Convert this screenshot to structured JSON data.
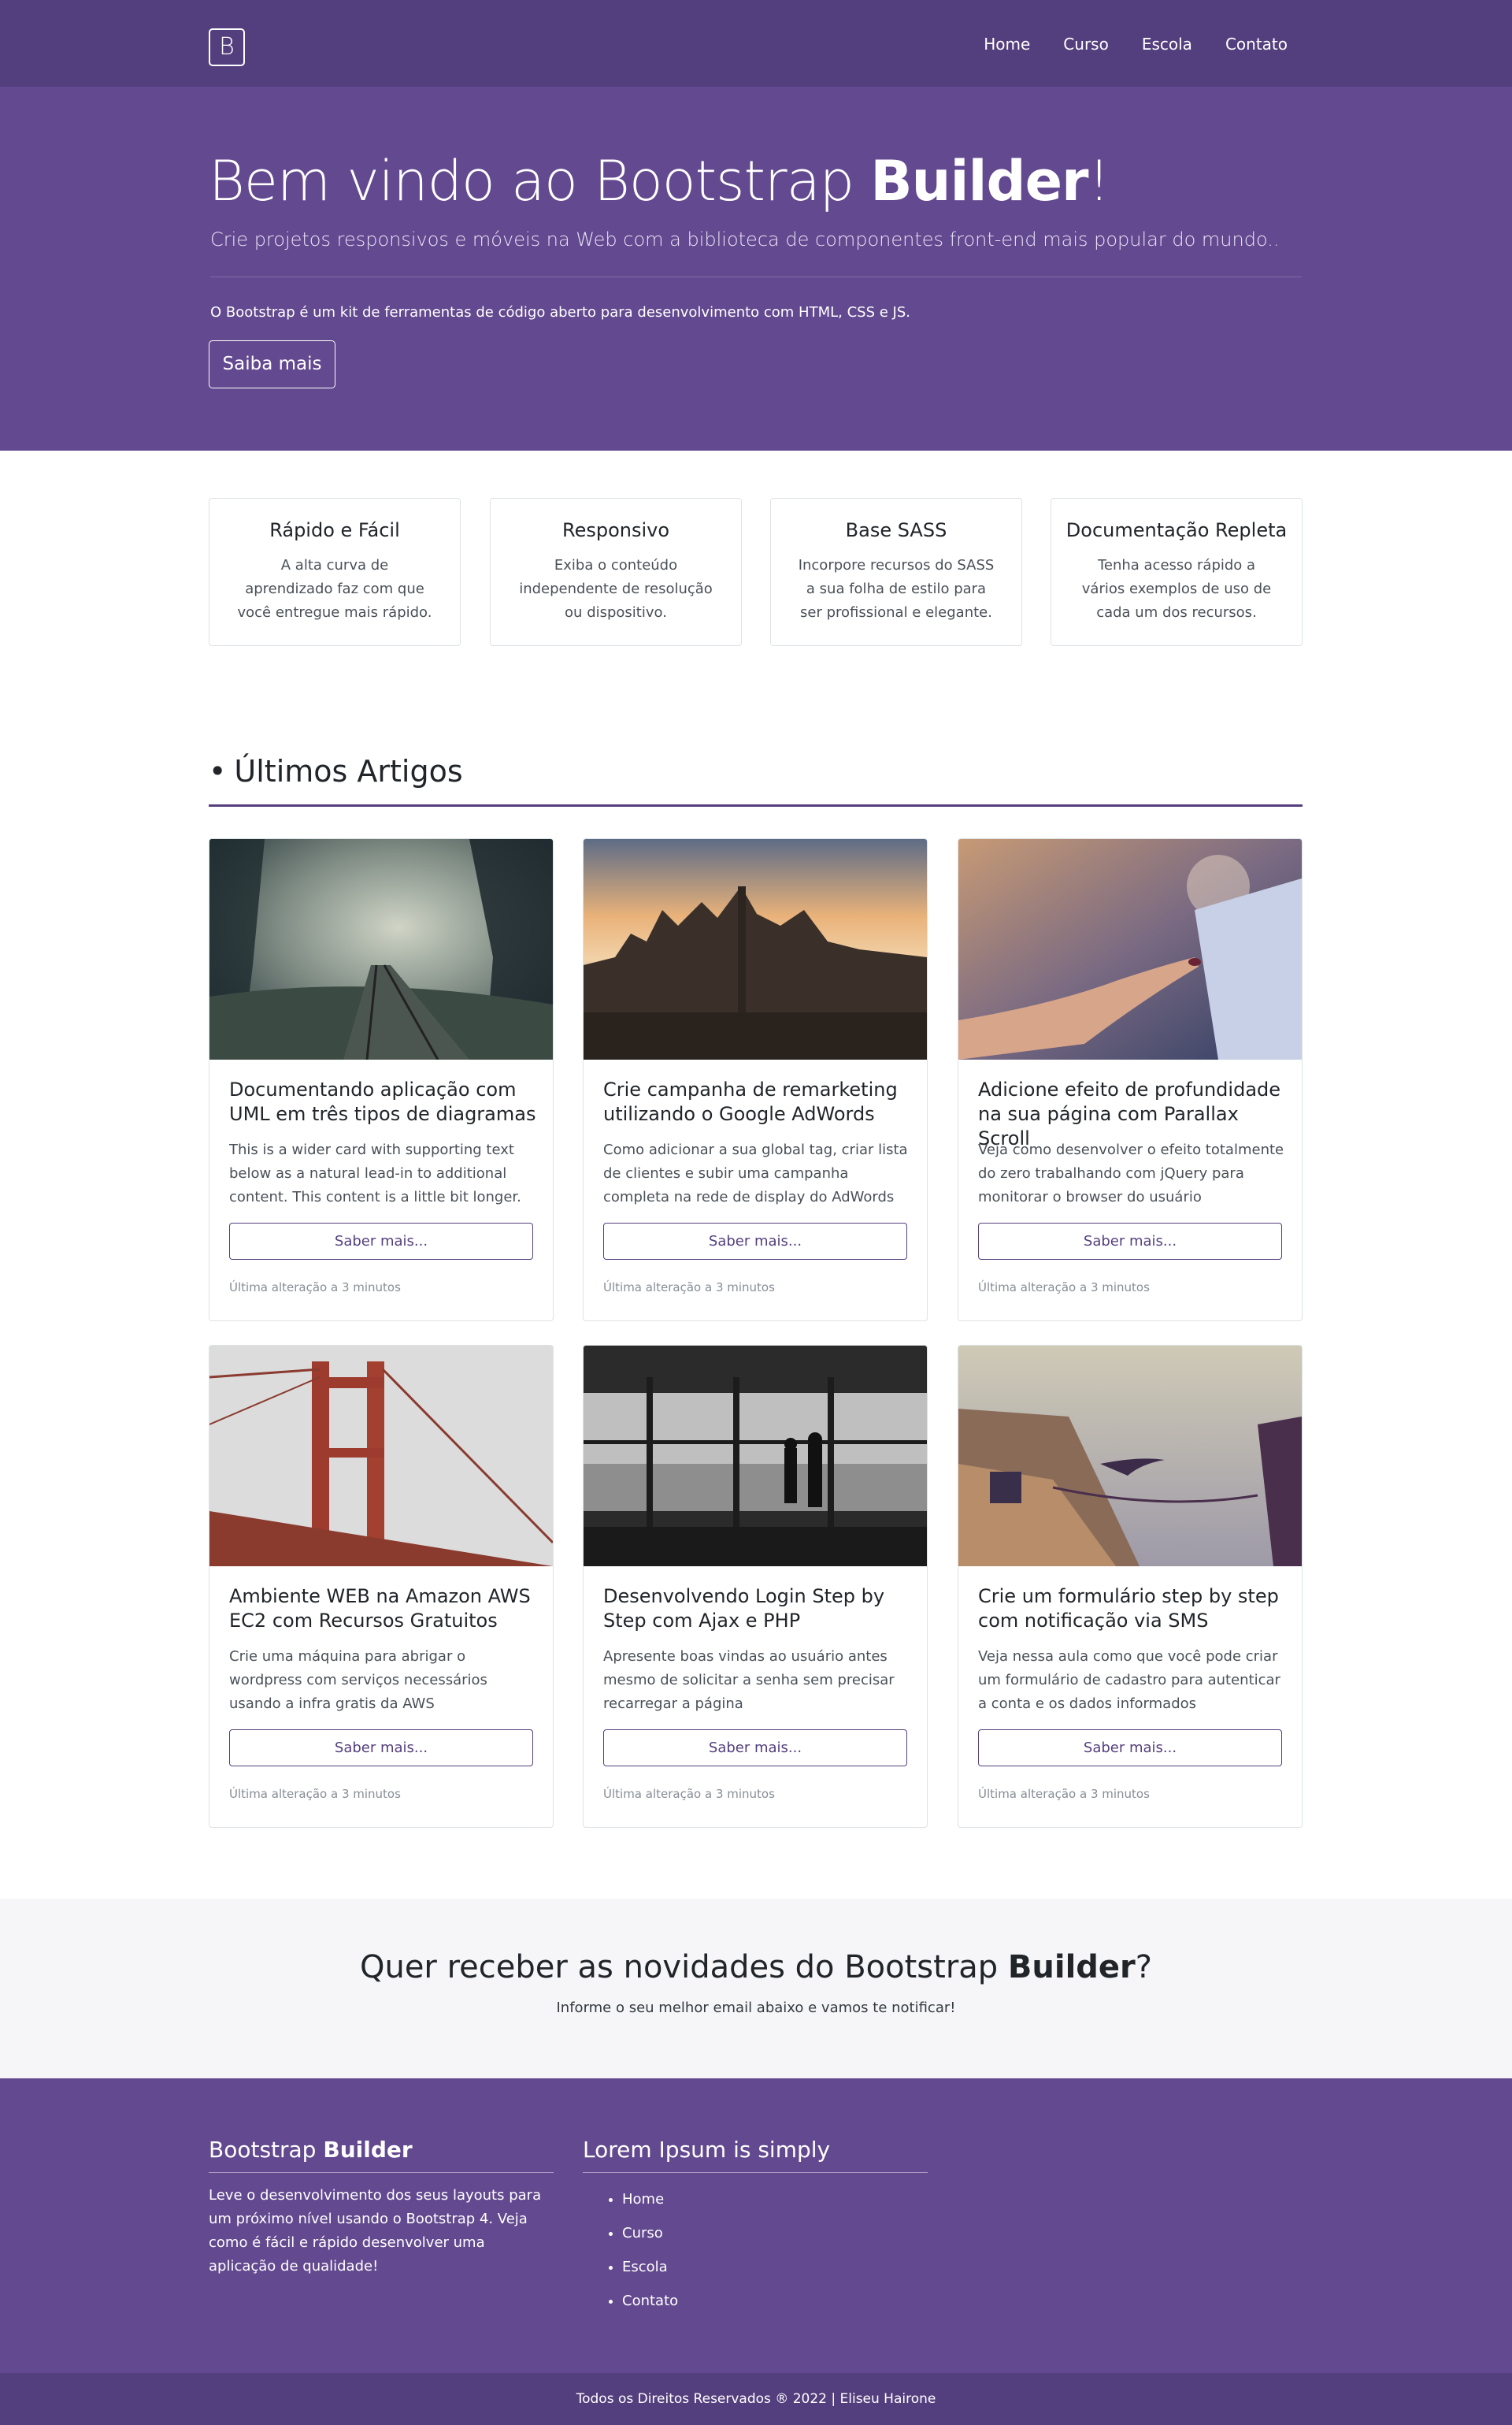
{
  "navbar": {
    "brand": "B",
    "links": [
      "Home",
      "Curso",
      "Escola",
      "Contato"
    ]
  },
  "hero": {
    "title_prefix": "Bem vindo ao Bootstrap ",
    "title_bold": "Builder",
    "title_suffix": "!",
    "lead": "Crie projetos responsivos e móveis na Web com a biblioteca de componentes front-end mais popular do mundo..",
    "description": "O Bootstrap é um kit de ferramentas de código aberto para desenvolvimento com HTML, CSS e JS.",
    "cta": "Saiba mais"
  },
  "features": [
    {
      "title": "Rápido e Fácil",
      "text": "A alta curva de aprendizado faz com que você entregue mais rápido."
    },
    {
      "title": "Responsivo",
      "text": "Exiba o conteúdo independente de resolução ou dispositivo."
    },
    {
      "title": "Base SASS",
      "text": "Incorpore recursos do SASS a sua folha de estilo para ser profissional e elegante."
    },
    {
      "title": "Documentação Repleta",
      "text": "Tenha acesso rápido a vários exemplos de uso de cada um dos recursos."
    }
  ],
  "articles": {
    "bullet": "•",
    "title": "Últimos Artigos",
    "cards": [
      {
        "title": "Documentando aplicação com UML em três tipos de diagramas",
        "text": "This is a wider card with supporting text below as a natural lead-in to additional content. This content is a little bit longer.",
        "button": "Saber mais...",
        "meta": "Última alteração a 3 minutos"
      },
      {
        "title": "Crie campanha de remarketing utilizando o Google AdWords",
        "text": "Como adicionar a sua global tag, criar lista de clientes e subir uma campanha completa na rede de display do AdWords",
        "button": "Saber mais...",
        "meta": "Última alteração a 3 minutos"
      },
      {
        "title": "Adicione efeito de profundidade na sua página com Parallax Scroll",
        "text": "Veja como desenvolver o efeito totalmente do zero trabalhando com jQuery para monitorar o browser do usuário",
        "button": "Saber mais...",
        "meta": "Última alteração a 3 minutos"
      },
      {
        "title": "Ambiente WEB na Amazon AWS EC2 com Recursos Gratuitos",
        "text": "Crie uma máquina para abrigar o wordpress com serviços necessários usando a infra gratis da AWS",
        "button": "Saber mais...",
        "meta": "Última alteração a 3 minutos"
      },
      {
        "title": "Desenvolvendo Login Step by Step com Ajax e PHP",
        "text": "Apresente boas vindas ao usuário antes mesmo de solicitar a senha sem precisar recarregar a página",
        "button": "Saber mais...",
        "meta": "Última alteração a 3 minutos"
      },
      {
        "title": "Crie um formulário step by step com notificação via SMS",
        "text": "Veja nessa aula como que você pode criar um formulário de cadastro para autenticar a conta e os dados informados",
        "button": "Saber mais...",
        "meta": "Última alteração a 3 minutos"
      }
    ]
  },
  "newsletter": {
    "title_prefix": "Quer receber as novidades do Bootstrap ",
    "title_bold": "Builder",
    "title_suffix": "?",
    "text": "Informe o seu melhor email abaixo e vamos te notificar!"
  },
  "footer": {
    "col1_title_prefix": "Bootstrap ",
    "col1_title_bold": "Builder",
    "col1_text": "Leve o desenvolvimento dos seus layouts para um próximo nível usando o Bootstrap 4. Veja como é fácil e rápido desenvolver uma aplicação de qualidade!",
    "col2_title": "Lorem Ipsum is simply",
    "col2_links": [
      "Home",
      "Curso",
      "Escola",
      "Contato"
    ],
    "copyright": "Todos os Direitos Reservados ® 2022 | Eliseu Hairone"
  },
  "colors": {
    "nav": "#543f7e",
    "hero": "#63498f",
    "accent": "#543f7e"
  }
}
